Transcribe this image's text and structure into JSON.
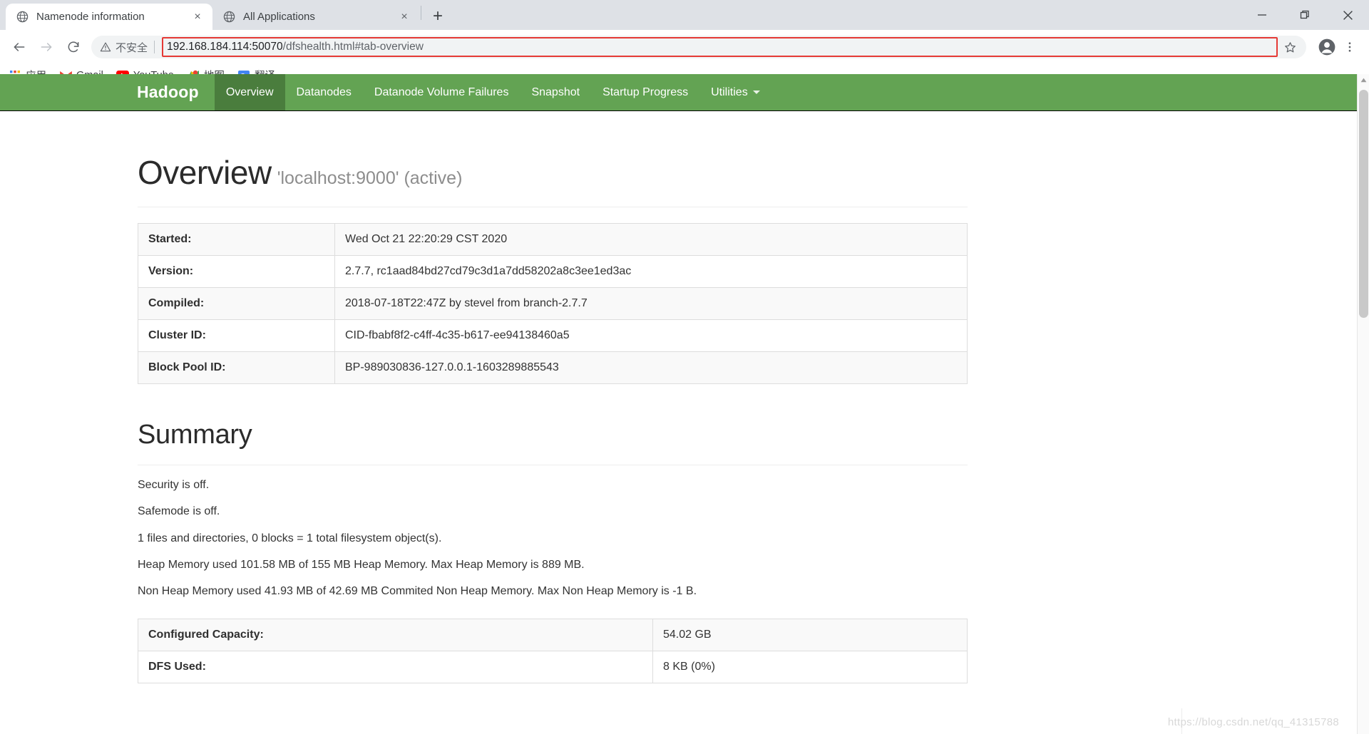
{
  "browser": {
    "tabs": [
      {
        "title": "Namenode information",
        "favicon": "globe-icon",
        "active": true,
        "close_label": "×"
      },
      {
        "title": "All Applications",
        "favicon": "globe-icon",
        "active": false,
        "close_label": "×"
      }
    ],
    "new_tab_label": "+",
    "window_controls": {
      "minimize": "—",
      "maximize": "❐",
      "close": "✕"
    },
    "toolbar": {
      "back_label": "←",
      "forward_label": "→",
      "reload_label": "⟳",
      "security_text": "不安全",
      "security_icon": "warning-triangle-icon",
      "url_host": "192.168.184.114:50070",
      "url_path": "/dfshealth.html#tab-overview",
      "url_full": "192.168.184.114:50070/dfshealth.html#tab-overview",
      "url_highlight_color": "#e53935",
      "bookmark_star_label": "☆",
      "profile_label": "account-icon",
      "menu_label": "⋮"
    },
    "bookmarks": [
      {
        "label": "应用",
        "icon": "apps-grid-icon"
      },
      {
        "label": "Gmail",
        "icon": "gmail-icon"
      },
      {
        "label": "YouTube",
        "icon": "youtube-icon"
      },
      {
        "label": "地图",
        "icon": "maps-icon"
      },
      {
        "label": "翻译",
        "icon": "translate-icon"
      }
    ]
  },
  "hadoop": {
    "brand": "Hadoop",
    "nav_color": "#63a353",
    "nav_active_color": "#4a7d3d",
    "nav_items": [
      {
        "label": "Overview",
        "active": true,
        "dropdown": false
      },
      {
        "label": "Datanodes",
        "active": false,
        "dropdown": false
      },
      {
        "label": "Datanode Volume Failures",
        "active": false,
        "dropdown": false
      },
      {
        "label": "Snapshot",
        "active": false,
        "dropdown": false
      },
      {
        "label": "Startup Progress",
        "active": false,
        "dropdown": false
      },
      {
        "label": "Utilities",
        "active": false,
        "dropdown": true
      }
    ]
  },
  "overview": {
    "heading": "Overview",
    "subheading": "'localhost:9000' (active)",
    "rows": [
      {
        "key": "Started:",
        "value": "Wed Oct 21 22:20:29 CST 2020"
      },
      {
        "key": "Version:",
        "value": "2.7.7, rc1aad84bd27cd79c3d1a7dd58202a8c3ee1ed3ac"
      },
      {
        "key": "Compiled:",
        "value": "2018-07-18T22:47Z by stevel from branch-2.7.7"
      },
      {
        "key": "Cluster ID:",
        "value": "CID-fbabf8f2-c4ff-4c35-b617-ee94138460a5"
      },
      {
        "key": "Block Pool ID:",
        "value": "BP-989030836-127.0.0.1-1603289885543"
      }
    ]
  },
  "summary": {
    "heading": "Summary",
    "lines": [
      "Security is off.",
      "Safemode is off.",
      "1 files and directories, 0 blocks = 1 total filesystem object(s).",
      "Heap Memory used 101.58 MB of 155 MB Heap Memory. Max Heap Memory is 889 MB.",
      "Non Heap Memory used 41.93 MB of 42.69 MB Commited Non Heap Memory. Max Non Heap Memory is -1 B."
    ],
    "capacity_rows": [
      {
        "key": "Configured Capacity:",
        "value": "54.02 GB"
      },
      {
        "key": "DFS Used:",
        "value": "8 KB (0%)"
      }
    ]
  },
  "watermark": "https://blog.csdn.net/qq_41315788"
}
